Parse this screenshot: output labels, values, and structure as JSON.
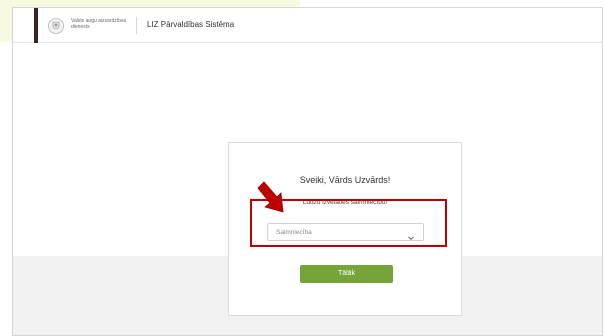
{
  "header": {
    "org_name": "Valsts augu aizsardzības dienests",
    "app_title": "LIZ Pārvaldības Sistēma"
  },
  "card": {
    "greeting": "Sveiki, Vārds Uzvārds!",
    "instruction": "Lūdzu izvēlaties saimniecību!",
    "select": {
      "value": "Saimniecība"
    },
    "next_label": "Tālāk"
  },
  "colors": {
    "brand_dark": "#3b2224",
    "accent_green": "#76a33a",
    "annotation_red": "#c00000"
  },
  "icons": {
    "logo": "coat-of-arms-icon",
    "select_toggle": "chevron-down-icon",
    "annotation": "arrow-pointer-icon"
  }
}
